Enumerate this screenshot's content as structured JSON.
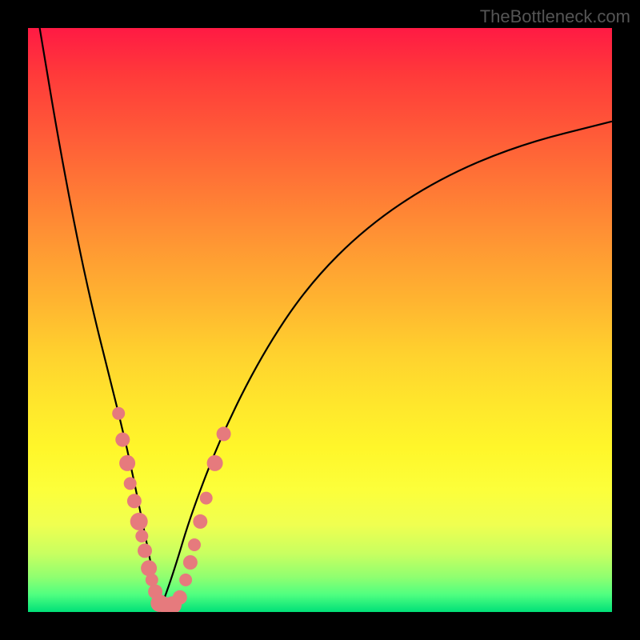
{
  "watermark": "TheBottleneck.com",
  "chart_data": {
    "type": "line",
    "title": "",
    "xlabel": "",
    "ylabel": "",
    "x_range": [
      0,
      1
    ],
    "y_range": [
      0,
      1
    ],
    "description": "V-shaped bottleneck curve on rainbow gradient (red top = high bottleneck, green bottom = low). Minimum occurs near x≈0.225.",
    "series": [
      {
        "name": "left-branch",
        "x": [
          0.02,
          0.05,
          0.08,
          0.11,
          0.14,
          0.17,
          0.195,
          0.215,
          0.225
        ],
        "y": [
          1.0,
          0.82,
          0.66,
          0.52,
          0.4,
          0.28,
          0.16,
          0.06,
          0.0
        ]
      },
      {
        "name": "right-branch",
        "x": [
          0.225,
          0.25,
          0.28,
          0.33,
          0.4,
          0.48,
          0.58,
          0.7,
          0.84,
          1.0
        ],
        "y": [
          0.0,
          0.07,
          0.17,
          0.3,
          0.44,
          0.56,
          0.66,
          0.74,
          0.8,
          0.84
        ]
      }
    ],
    "markers": {
      "name": "data-points",
      "color": "#e67a7d",
      "points": [
        {
          "x": 0.155,
          "y": 0.34,
          "r": 8
        },
        {
          "x": 0.162,
          "y": 0.295,
          "r": 9
        },
        {
          "x": 0.17,
          "y": 0.255,
          "r": 10
        },
        {
          "x": 0.175,
          "y": 0.22,
          "r": 8
        },
        {
          "x": 0.182,
          "y": 0.19,
          "r": 9
        },
        {
          "x": 0.19,
          "y": 0.155,
          "r": 11
        },
        {
          "x": 0.195,
          "y": 0.13,
          "r": 8
        },
        {
          "x": 0.2,
          "y": 0.105,
          "r": 9
        },
        {
          "x": 0.207,
          "y": 0.075,
          "r": 10
        },
        {
          "x": 0.212,
          "y": 0.055,
          "r": 8
        },
        {
          "x": 0.218,
          "y": 0.035,
          "r": 9
        },
        {
          "x": 0.225,
          "y": 0.015,
          "r": 11
        },
        {
          "x": 0.235,
          "y": 0.012,
          "r": 10
        },
        {
          "x": 0.248,
          "y": 0.012,
          "r": 11
        },
        {
          "x": 0.26,
          "y": 0.025,
          "r": 9
        },
        {
          "x": 0.27,
          "y": 0.055,
          "r": 8
        },
        {
          "x": 0.278,
          "y": 0.085,
          "r": 9
        },
        {
          "x": 0.285,
          "y": 0.115,
          "r": 8
        },
        {
          "x": 0.295,
          "y": 0.155,
          "r": 9
        },
        {
          "x": 0.305,
          "y": 0.195,
          "r": 8
        },
        {
          "x": 0.32,
          "y": 0.255,
          "r": 10
        },
        {
          "x": 0.335,
          "y": 0.305,
          "r": 9
        }
      ]
    }
  }
}
